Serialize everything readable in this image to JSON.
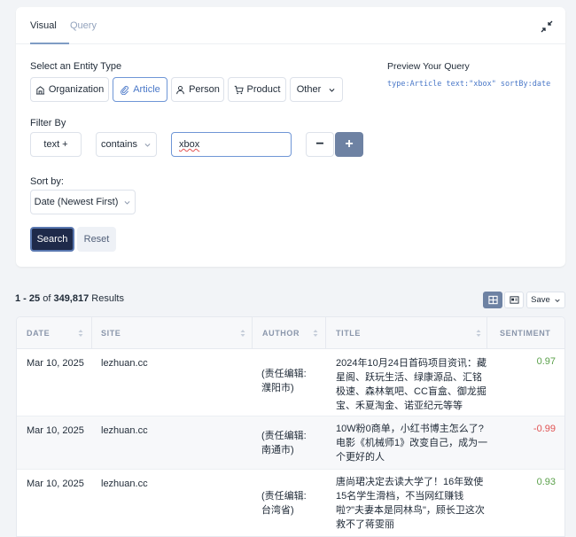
{
  "tabs": [
    {
      "label": "Visual"
    },
    {
      "label": "Query"
    }
  ],
  "entity_type": {
    "label": "Select an Entity Type",
    "options": [
      {
        "label": "Organization",
        "icon": "building-icon"
      },
      {
        "label": "Article",
        "icon": "paperclip-icon"
      },
      {
        "label": "Person",
        "icon": "person-icon"
      },
      {
        "label": "Product",
        "icon": "cart-icon"
      },
      {
        "label": "Other"
      }
    ]
  },
  "preview": {
    "title": "Preview Your Query",
    "query": "type:Article text:\"xbox\" sortBy:date"
  },
  "filter": {
    "label": "Filter By",
    "field": "text +",
    "operator": "contains",
    "value": "xbox",
    "minus": "−",
    "plus": "+"
  },
  "sort": {
    "label": "Sort by:",
    "value": "Date (Newest First)"
  },
  "actions": {
    "search": "Search",
    "reset": "Reset"
  },
  "results": {
    "range": "1 - 25",
    "of": "of",
    "total": "349,817",
    "suffix": "Results",
    "save": "Save"
  },
  "table": {
    "headers": [
      "DATE",
      "SITE",
      "AUTHOR",
      "TITLE",
      "SENTIMENT"
    ],
    "rows": [
      {
        "date": "Mar 10, 2025",
        "site": "lezhuan.cc",
        "author": "(责任编辑:濮阳市)",
        "title": "2024年10月24日首码项目资讯：藏星阁、跃玩生活、绿康源品、汇铭极速、森林氧吧、CC盲盒、御龙掘宝、禾夏淘金、诺亚纪元等等",
        "sentiment": "0.97",
        "sentiment_color": "#5aa04a"
      },
      {
        "date": "Mar 10, 2025",
        "site": "lezhuan.cc",
        "author": "(责任编辑:南通市)",
        "title": "10W粉0商单，小红书博主怎么了?电影《机械师1》改变自己，成为一个更好的人",
        "sentiment": "-0.99",
        "sentiment_color": "#e05252"
      },
      {
        "date": "Mar 10, 2025",
        "site": "lezhuan.cc",
        "author": "(责任编辑:台湾省)",
        "title": "唐尚珺决定去读大学了！16年致使15名学生滑档，不当网红赚钱啦?\"夫妻本是同林鸟\"，顾长卫这次救不了蒋雯丽",
        "sentiment": "0.93",
        "sentiment_color": "#5aa04a"
      }
    ]
  }
}
